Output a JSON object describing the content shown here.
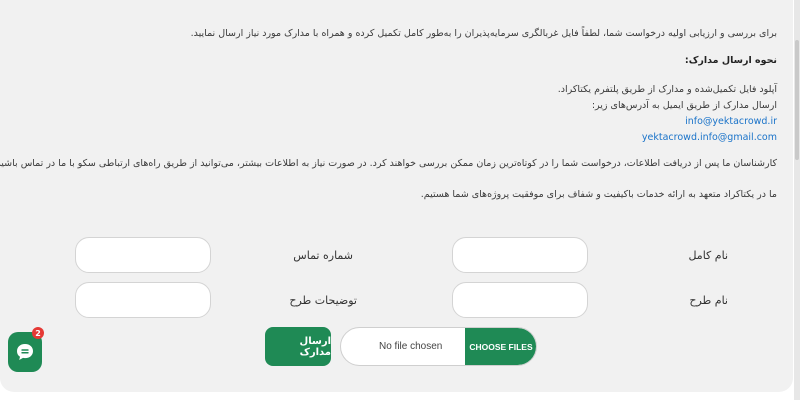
{
  "intro": {
    "line1": "برای بررسی و ارزیابی اولیه درخواست شما، لطفاً فایل غربالگری سرمایه‌پذیران را به‌طور کامل تکمیل کرده و همراه با مدارک مورد نیاز ارسال نمایید.",
    "heading": "نحوه ارسال مدارک:",
    "upload_line": "آپلود فایل تکمیل‌شده و مدارک از طریق پلتفرم یکتاکراد.",
    "email_line": "ارسال مدارک از طریق ایمیل به آدرس‌های زیر:",
    "email1": "info@yektacrowd.ir",
    "email2": "yektacrowd.info@gmail.com",
    "review_line": "کارشناسان ما پس از دریافت اطلاعات، درخواست شما را در کوتاه‌ترین زمان ممکن بررسی خواهند کرد. در صورت نیاز به اطلاعات بیشتر، می‌توانید از طریق راه‌های ارتباطی سکو با ما در تماس باشید.",
    "closing_line": "ما در یکتاکراد متعهد به ارائه خدمات باکیفیت و شفاف برای موفقیت پروژه‌های شما هستیم."
  },
  "form": {
    "full_name_label": "نام کامل",
    "phone_label": "شماره تماس",
    "project_name_label": "نام طرح",
    "project_desc_label": "توضیحات طرح",
    "full_name_value": "",
    "phone_value": "",
    "project_name_value": "",
    "project_desc_value": "",
    "file_button_label": "CHOOSE FILES",
    "file_status": "No file chosen",
    "submit_label": "ارسال مدارک"
  },
  "chat": {
    "icon": "chat-bubble-icon",
    "badge_count": "2"
  },
  "colors": {
    "accent": "#1f8a55",
    "link": "#1a73c9",
    "badge": "#e53935",
    "panel_bg": "#f1f1f1"
  }
}
